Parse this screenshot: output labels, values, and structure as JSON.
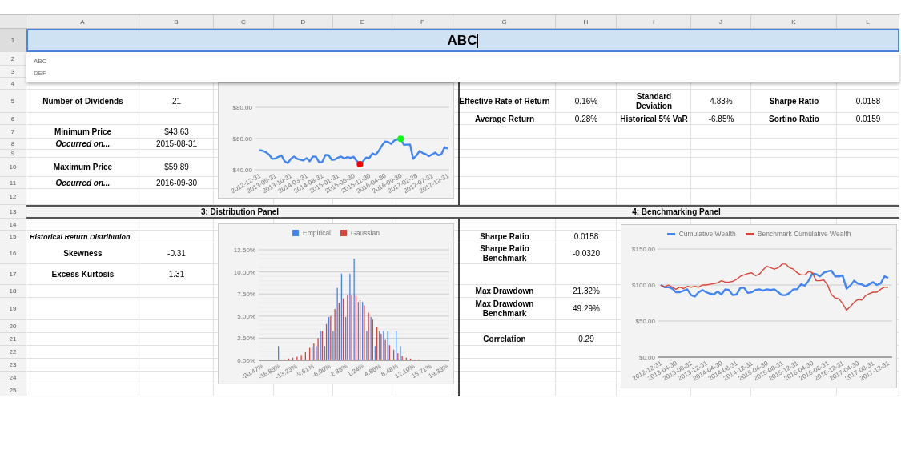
{
  "column_headers": [
    "A",
    "B",
    "C",
    "D",
    "E",
    "F",
    "G",
    "H",
    "I",
    "J",
    "K",
    "L"
  ],
  "row_headers": [
    "1",
    "2",
    "3",
    "4",
    "5",
    "6",
    "7",
    "8",
    "9",
    "10",
    "11",
    "12",
    "13",
    "14",
    "15",
    "16",
    "17",
    "18",
    "19",
    "20",
    "21",
    "22",
    "23",
    "24",
    "25"
  ],
  "editor": {
    "value": "ABC"
  },
  "autocomplete": [
    "ABC",
    "DEF"
  ],
  "summary": [
    {
      "label": "Number of Dividends",
      "value": "21",
      "kind": "label"
    },
    {
      "label": "Minimum Price",
      "value": "$43.63",
      "kind": "label"
    },
    {
      "label": "Occurred on...",
      "value": "2015-08-31",
      "kind": "emphasis"
    },
    {
      "label": "Maximum Price",
      "value": "$59.89",
      "kind": "label"
    },
    {
      "label": "Occurred on...",
      "value": "2016-09-30",
      "kind": "emphasis"
    }
  ],
  "metric_groups": [
    {
      "items": [
        {
          "label": "Effective Rate of Return",
          "value": "0.16%"
        },
        {
          "label": "Average Return",
          "value": "0.28%"
        }
      ]
    },
    {
      "items": [
        {
          "label": "Standard\nDeviation",
          "value": "4.83%"
        },
        {
          "label": "Historical 5% VaR",
          "value": "-6.85%"
        }
      ]
    },
    {
      "items": [
        {
          "label": "Sharpe Ratio",
          "value": "0.0158"
        },
        {
          "label": "Sortino Ratio",
          "value": "0.0159"
        }
      ]
    }
  ],
  "panel_headers": [
    "3: Distribution Panel",
    "4: Benchmarking Panel"
  ],
  "distribution": {
    "title": "Historical Return Distribution",
    "stats": [
      {
        "label": "Skewness",
        "value": "-0.31"
      },
      {
        "label": "Excess Kurtosis",
        "value": "1.31"
      }
    ]
  },
  "benchmark_stats": [
    {
      "label": "Sharpe Ratio",
      "value": "0.0158"
    },
    {
      "label": "Sharpe Ratio\nBenchmark",
      "value": "-0.0320"
    },
    {
      "label": "Max Drawdown",
      "value": "21.32%"
    },
    {
      "label": "Max Drawdown\nBenchmark",
      "value": "49.29%"
    },
    {
      "label": "Correlation",
      "value": "0.29"
    }
  ],
  "charts": [
    {
      "chart_data": {
        "type": "line",
        "grid": true,
        "ylim": [
          40,
          80
        ],
        "yticks": [
          {
            "value": 40,
            "label": "$40.00"
          },
          {
            "value": 60,
            "label": "$60.00"
          },
          {
            "value": 80,
            "label": "$80.00"
          }
        ],
        "categories": [
          "2012-12-31",
          null,
          null,
          null,
          null,
          "2013-05-31",
          null,
          null,
          null,
          null,
          "2013-10-31",
          null,
          null,
          null,
          null,
          "2014-03-31",
          null,
          null,
          null,
          null,
          "2014-08-31",
          null,
          null,
          null,
          null,
          "2015-01-31",
          null,
          null,
          null,
          null,
          "2015-06-30",
          null,
          null,
          null,
          null,
          "2015-11-30",
          null,
          null,
          null,
          null,
          "2016-04-30",
          null,
          null,
          null,
          null,
          "2016-09-30",
          null,
          null,
          null,
          null,
          "2017-02-28",
          null,
          null,
          null,
          null,
          "2017-07-31",
          null,
          null,
          null,
          null,
          "2017-12-31"
        ],
        "series": [
          {
            "color": "#4285f4",
            "values": [
              52.6,
              52.2,
              51.3,
              49.8,
              47.0,
              47.2,
              48.3,
              49.2,
              45.5,
              44.3,
              47.0,
              48.5,
              47.0,
              46.5,
              46.0,
              47.5,
              45.5,
              48.5,
              48.3,
              44.8,
              45.0,
              49.5,
              49.4,
              46.4,
              46.5,
              47.8,
              48.5,
              47.2,
              48.1,
              47.6,
              48.3,
              45.7,
              43.6,
              45.5,
              47.8,
              47.5,
              50.5,
              49.6,
              52.0,
              55.5,
              58.1,
              57.8,
              56.5,
              58.8,
              59.5,
              59.9,
              56.0,
              56.1,
              56.2,
              47.0,
              49.0,
              52.0,
              50.7,
              50.0,
              48.7,
              49.8,
              51.0,
              49.3,
              50.0,
              54.5,
              53.5
            ]
          },
          {
            "color": "#ff0000",
            "marker": true,
            "values": [
              null,
              null,
              null,
              null,
              null,
              null,
              null,
              null,
              null,
              null,
              null,
              null,
              null,
              null,
              null,
              null,
              null,
              null,
              null,
              null,
              null,
              null,
              null,
              null,
              null,
              null,
              null,
              null,
              null,
              null,
              null,
              null,
              43.6,
              null,
              null,
              null,
              null,
              null,
              null,
              null,
              null,
              null,
              null,
              null,
              null,
              null,
              null,
              null,
              null,
              null,
              null,
              null,
              null,
              null,
              null,
              null,
              null,
              null,
              null,
              null,
              null
            ]
          },
          {
            "color": "#00ff00",
            "marker": true,
            "values": [
              null,
              null,
              null,
              null,
              null,
              null,
              null,
              null,
              null,
              null,
              null,
              null,
              null,
              null,
              null,
              null,
              null,
              null,
              null,
              null,
              null,
              null,
              null,
              null,
              null,
              null,
              null,
              null,
              null,
              null,
              null,
              null,
              null,
              null,
              null,
              null,
              null,
              null,
              null,
              null,
              null,
              null,
              null,
              null,
              null,
              59.9,
              null,
              null,
              null,
              null,
              null,
              null,
              null,
              null,
              null,
              null,
              null,
              null,
              null,
              null,
              null
            ]
          }
        ]
      }
    },
    {
      "chart_data": {
        "type": "bar",
        "grid": true,
        "legend": "top",
        "ylim": [
          0,
          12.5
        ],
        "yticks": [
          {
            "value": 0,
            "label": "0.00%"
          },
          {
            "value": 2.5,
            "label": "2.50%"
          },
          {
            "value": 5,
            "label": "5.00%"
          },
          {
            "value": 7.5,
            "label": "7.50%"
          },
          {
            "value": 10,
            "label": "10.00%"
          },
          {
            "value": 12.5,
            "label": "12.50%"
          }
        ],
        "categories": [
          "-20.47%",
          null,
          null,
          null,
          "-16.85%",
          null,
          null,
          null,
          "-13.23%",
          null,
          null,
          null,
          "-9.61%",
          null,
          null,
          null,
          "-6.00%",
          null,
          null,
          null,
          "-2.38%",
          null,
          null,
          null,
          "1.24%",
          null,
          null,
          null,
          "4.86%",
          null,
          null,
          null,
          "8.48%",
          null,
          null,
          null,
          "12.10%",
          null,
          null,
          null,
          "15.71%",
          null,
          null,
          null,
          "19.33%"
        ],
        "series": [
          {
            "name": "Empirical",
            "color": "#4285f4",
            "values": [
              0,
              0,
              0,
              0,
              1.6,
              0,
              0,
              0,
              0,
              0,
              0,
              0,
              1.6,
              1.6,
              3.3,
              1.6,
              4.9,
              3.3,
              8.2,
              9.8,
              4.9,
              9.8,
              11.5,
              6.6,
              6.6,
              3.3,
              4.9,
              1.6,
              3.3,
              3.3,
              3.3,
              0,
              3.3,
              1.6,
              0,
              0,
              0,
              0,
              0,
              0,
              0,
              0,
              0,
              0,
              0
            ]
          },
          {
            "name": "Gaussian",
            "color": "#db4437",
            "values": [
              0,
              0,
              0,
              0,
              0.1,
              0.1,
              0.2,
              0.3,
              0.4,
              0.6,
              0.9,
              1.4,
              1.9,
              2.5,
              3.3,
              4.1,
              5.0,
              5.8,
              6.5,
              7.0,
              7.4,
              7.4,
              7.3,
              6.8,
              6.2,
              5.4,
              4.6,
              3.8,
              3.0,
              2.3,
              1.7,
              1.2,
              0.8,
              0.5,
              0.3,
              0.2,
              0.1,
              0.1,
              0,
              0,
              0,
              0,
              0,
              0,
              0
            ]
          }
        ]
      }
    },
    {
      "chart_data": {
        "type": "line",
        "grid": true,
        "legend": "top",
        "ylim": [
          0,
          150
        ],
        "yticks": [
          {
            "value": 0,
            "label": "$0.00"
          },
          {
            "value": 50,
            "label": "$50.00"
          },
          {
            "value": 100,
            "label": "$100.00"
          },
          {
            "value": 150,
            "label": "$150.00"
          }
        ],
        "categories": [
          "2012-12-31",
          null,
          null,
          null,
          "2013-04-30",
          null,
          null,
          null,
          "2013-08-31",
          null,
          null,
          null,
          "2013-12-31",
          null,
          null,
          null,
          "2014-04-30",
          null,
          null,
          null,
          "2014-08-31",
          null,
          null,
          null,
          "2014-12-31",
          null,
          null,
          null,
          "2015-04-30",
          null,
          null,
          null,
          "2015-08-31",
          null,
          null,
          null,
          "2015-12-31",
          null,
          null,
          null,
          "2016-04-30",
          null,
          null,
          null,
          "2016-08-31",
          null,
          null,
          null,
          "2016-12-31",
          null,
          null,
          null,
          "2017-04-30",
          null,
          null,
          null,
          "2017-08-31",
          null,
          null,
          null,
          "2017-12-31"
        ],
        "series": [
          {
            "name": "Cumulative Wealth",
            "color": "#4285f4",
            "values": [
              100,
              97,
              97,
              95,
              90,
              90,
              92,
              94,
              86,
              84,
              90,
              93,
              90,
              88,
              87,
              91,
              87,
              94,
              93,
              86,
              87,
              96,
              96,
              89,
              90,
              93,
              94,
              92,
              94,
              93,
              94,
              90,
              86,
              86,
              89,
              94,
              94,
              101,
              99,
              106,
              116,
              115,
              112,
              117,
              119,
              120,
              112,
              112,
              113,
              95,
              99,
              106,
              102,
              101,
              98,
              101,
              104,
              100,
              102,
              112,
              110
            ]
          },
          {
            "name": "Benchmark Cumulative Wealth",
            "color": "#db4437",
            "values": [
              100,
              97,
              100,
              97,
              94,
              97,
              95,
              98,
              97,
              98,
              97,
              100,
              100,
              101,
              102,
              103,
              106,
              104,
              104,
              105,
              108,
              112,
              114,
              116,
              117,
              113,
              115,
              121,
              126,
              124,
              122,
              124,
              129,
              129,
              124,
              122,
              117,
              114,
              114,
              119,
              117,
              106,
              106,
              107,
              100,
              87,
              82,
              81,
              74,
              65,
              70,
              76,
              80,
              79,
              85,
              88,
              90,
              90,
              94,
              97,
              97
            ]
          }
        ]
      }
    }
  ]
}
